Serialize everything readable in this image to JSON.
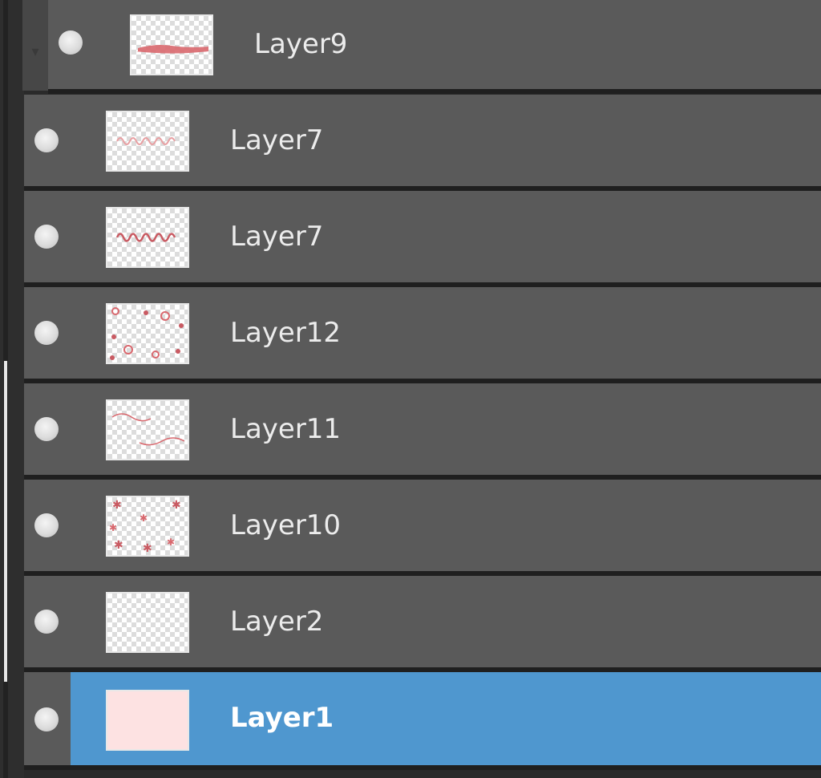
{
  "layers_panel": {
    "layers": [
      {
        "name": "Layer9",
        "thumbnail": "red-brush-stroke",
        "visible": true,
        "selected": false,
        "in_folder": true
      },
      {
        "name": "Layer7",
        "thumbnail": "faint-handwriting",
        "visible": true,
        "selected": false,
        "in_folder": false
      },
      {
        "name": "Layer7",
        "thumbnail": "handwriting",
        "visible": true,
        "selected": false,
        "in_folder": false
      },
      {
        "name": "Layer12",
        "thumbnail": "scattered-dots",
        "visible": true,
        "selected": false,
        "in_folder": false
      },
      {
        "name": "Layer11",
        "thumbnail": "wavy-lines",
        "visible": true,
        "selected": false,
        "in_folder": false
      },
      {
        "name": "Layer10",
        "thumbnail": "scattered-stars",
        "visible": true,
        "selected": false,
        "in_folder": false
      },
      {
        "name": "Layer2",
        "thumbnail": "empty",
        "visible": true,
        "selected": false,
        "in_folder": false
      },
      {
        "name": "Layer1",
        "thumbnail": "pink-fill",
        "visible": true,
        "selected": true,
        "in_folder": false
      }
    ]
  },
  "colors": {
    "row_background": "#5a5a5a",
    "selected_background": "#4f97cf",
    "separator": "#1f1f1f",
    "thumbnail_ink": "#d9686e",
    "layer1_fill": "#fde2e2"
  }
}
